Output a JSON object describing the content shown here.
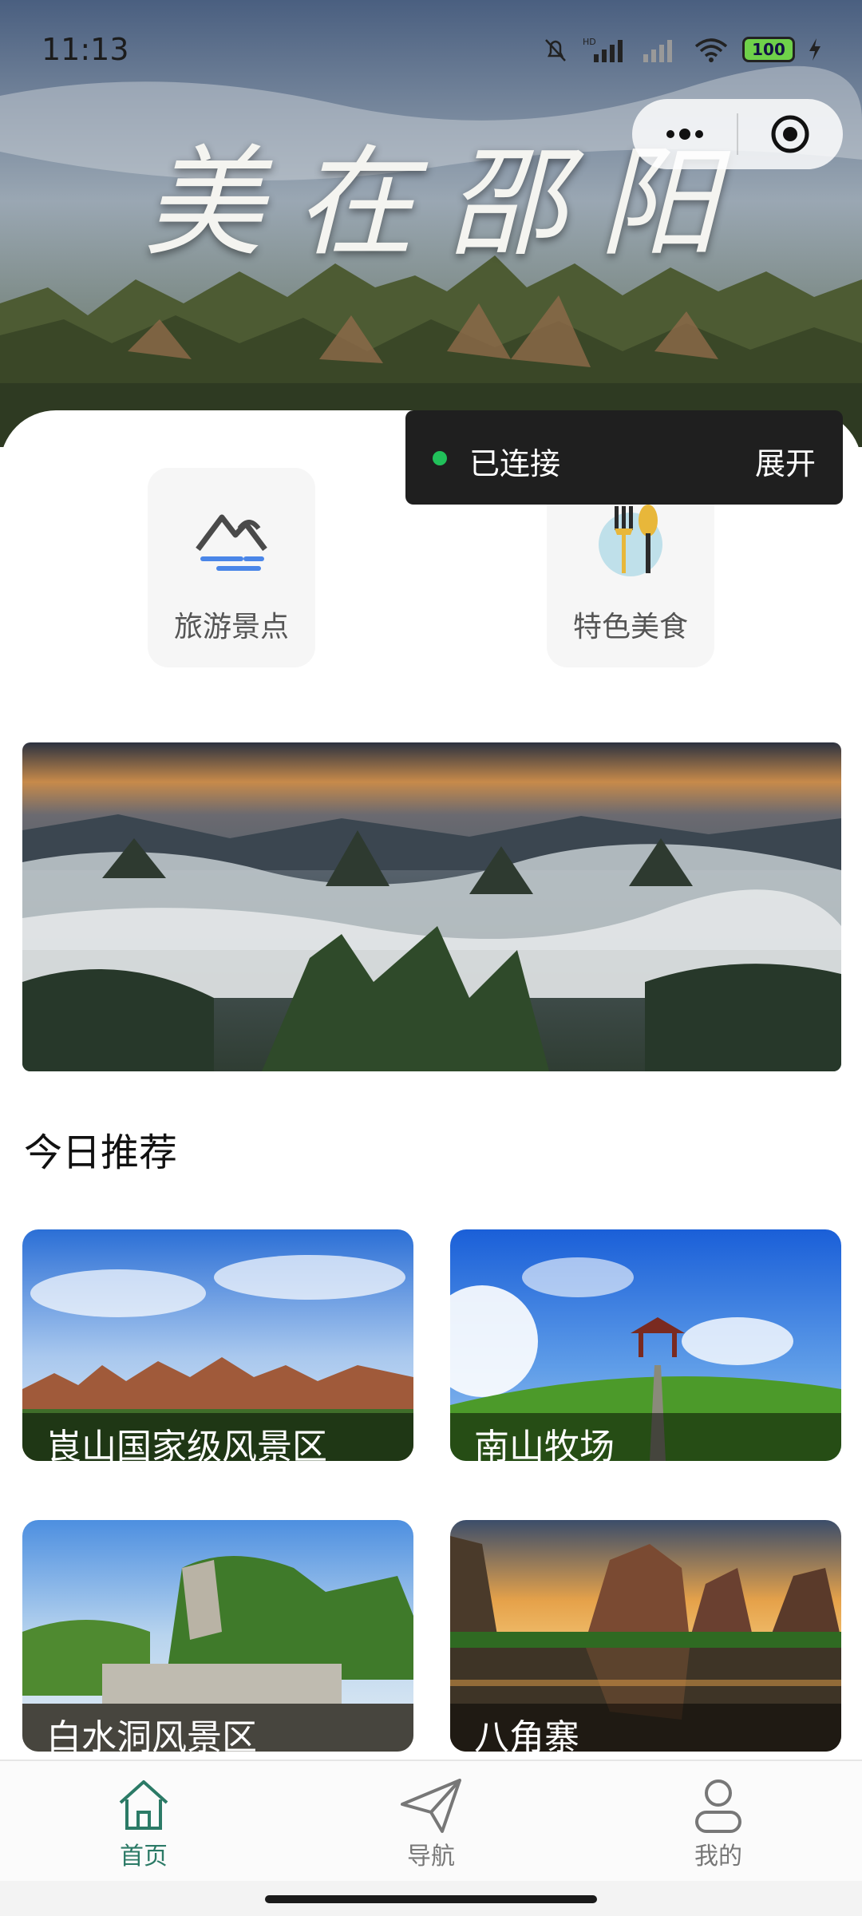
{
  "status_bar": {
    "time": "11:13",
    "battery": "100",
    "network_label": "HD"
  },
  "hero": {
    "title": "美在邵阳"
  },
  "capsule": {
    "more_icon": "more-dots-icon",
    "close_icon": "target-close-icon"
  },
  "categories": [
    {
      "label": "旅游景点",
      "icon": "mountain-icon"
    },
    {
      "label": "特色美食",
      "icon": "fork-spoon-icon"
    }
  ],
  "toast": {
    "message": "已连接",
    "action": "展开",
    "dot_color": "#21c05a"
  },
  "section": {
    "title": "今日推荐"
  },
  "recommendations": [
    {
      "name": "崀山国家级风景区"
    },
    {
      "name": "南山牧场"
    },
    {
      "name": "白水洞风景区"
    },
    {
      "name": "八角寨"
    }
  ],
  "tabbar": {
    "active_color": "#2b7a66",
    "items": [
      {
        "label": "首页",
        "icon": "home-icon",
        "active": true
      },
      {
        "label": "导航",
        "icon": "paper-plane-icon",
        "active": false
      },
      {
        "label": "我的",
        "icon": "user-icon",
        "active": false
      }
    ]
  }
}
